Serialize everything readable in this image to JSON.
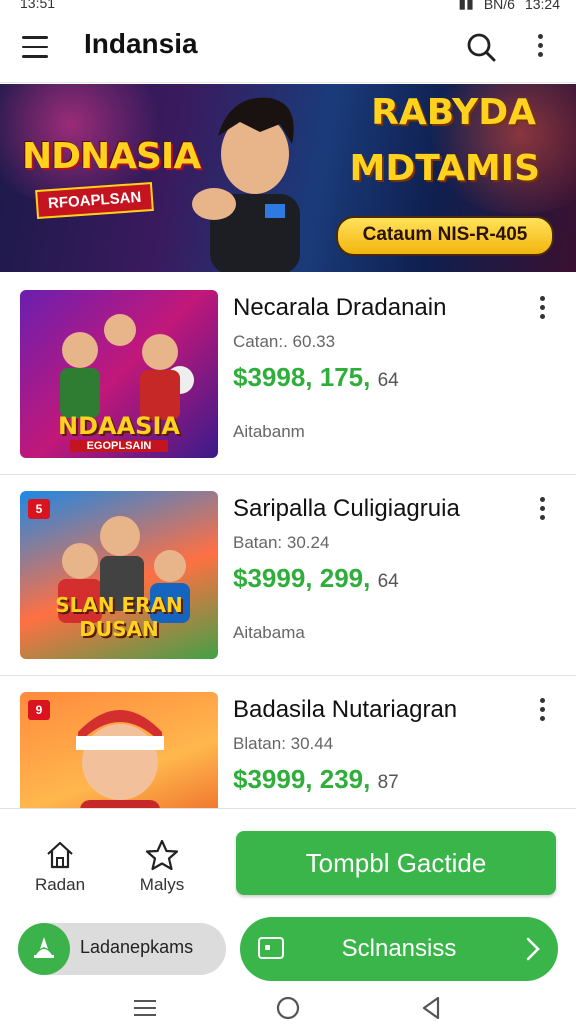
{
  "status": {
    "time": "13:51",
    "right_text": "BN/6",
    "clock": "13:24"
  },
  "appbar": {
    "title": "Indansia"
  },
  "banner": {
    "logo_main": "NDNASIA",
    "logo_sub": "RFOAPLSAN",
    "headline_1": "RABYDA",
    "headline_2": "MDTAMIS",
    "cta": "Cataum NIS-R-405"
  },
  "cards": [
    {
      "name": "Necarala Dradanain",
      "sub": "Catan:. 60.33",
      "price": "$3998, 175,",
      "price_suffix": "64",
      "meta": "Aitabanm",
      "thumb_title": "NDAASIA",
      "thumb_sub": "EGOPLSAIN",
      "badge": ""
    },
    {
      "name": "Saripalla Culigiagruia",
      "sub": "Batan: 30.24",
      "price": "$3999, 299,",
      "price_suffix": "64",
      "meta": "Aitabama",
      "thumb_title": "SLAN ERAN DUSAN",
      "thumb_sub": "",
      "badge": "5"
    },
    {
      "name": "Badasila Nutariagran",
      "sub": "Blatan: 30.44",
      "price": "$3999, 239,",
      "price_suffix": "87",
      "meta": "",
      "thumb_title": "",
      "thumb_sub": "",
      "badge": "9"
    }
  ],
  "bottom": {
    "nav": [
      {
        "label": "Radan",
        "icon": "home-icon"
      },
      {
        "label": "Malys",
        "icon": "star-icon"
      }
    ],
    "primary_button": "Tompbl Gactide",
    "pill_text": "Ladanepkams",
    "secondary_button": "Sclnansiss"
  }
}
